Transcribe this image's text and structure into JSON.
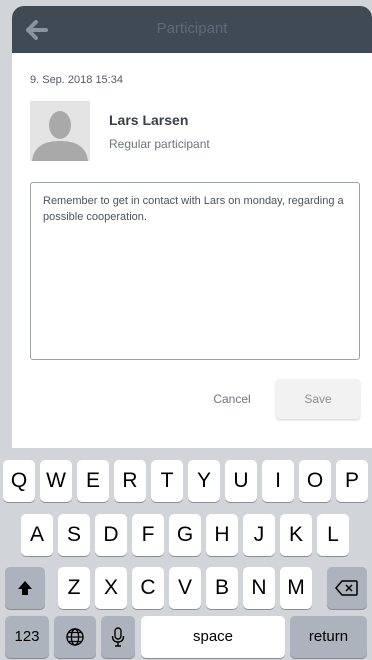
{
  "header": {
    "title": "Participant"
  },
  "entry": {
    "date": "9. Sep. 2018 15:34",
    "name": "Lars Larsen",
    "role": "Regular participant",
    "note": "Remember to get in contact with Lars on monday, regarding a possible cooperation."
  },
  "actions": {
    "cancel": "Cancel",
    "save": "Save"
  },
  "keyboard": {
    "row1": [
      "Q",
      "W",
      "E",
      "R",
      "T",
      "Y",
      "U",
      "I",
      "O",
      "P"
    ],
    "row2": [
      "A",
      "S",
      "D",
      "F",
      "G",
      "H",
      "J",
      "K",
      "L"
    ],
    "row3": [
      "Z",
      "X",
      "C",
      "V",
      "B",
      "N",
      "M"
    ],
    "numbers": "123",
    "space": "space",
    "return": "return"
  },
  "colors": {
    "header_bg": "#3f4a55",
    "keyboard_bg": "#d1d4d9"
  }
}
